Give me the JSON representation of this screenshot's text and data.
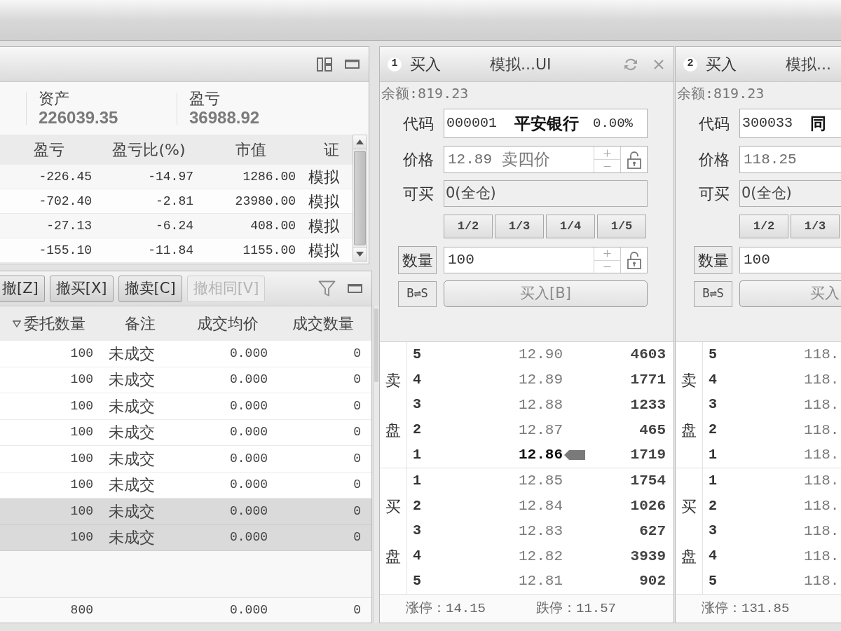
{
  "positions_panel": {
    "summary": [
      {
        "label": "资产",
        "value": "226039.35"
      },
      {
        "label": "盈亏",
        "value": "36988.92"
      }
    ],
    "table": {
      "columns": [
        "盈亏",
        "盈亏比(%)",
        "市值",
        "证"
      ],
      "rows": [
        [
          "-226.45",
          "-14.97",
          "1286.00",
          "模拟"
        ],
        [
          "-702.40",
          "-2.81",
          "23980.00",
          "模拟"
        ],
        [
          "-27.13",
          "-6.24",
          "408.00",
          "模拟"
        ],
        [
          "-155.10",
          "-11.84",
          "1155.00",
          "模拟"
        ]
      ]
    }
  },
  "orders_panel": {
    "buttons": [
      {
        "label": "撤[Z]",
        "disabled": false
      },
      {
        "label": "撤买[X]",
        "disabled": false
      },
      {
        "label": "撤卖[C]",
        "disabled": false
      },
      {
        "label": "撤相同[V]",
        "disabled": true
      }
    ],
    "table": {
      "columns": [
        {
          "label": "委托数量",
          "sorted": true
        },
        {
          "label": "备注",
          "sorted": false
        },
        {
          "label": "成交均价",
          "sorted": false
        },
        {
          "label": "成交数量",
          "sorted": false
        }
      ],
      "rows": [
        {
          "cells": [
            "100",
            "未成交",
            "0.000",
            "0"
          ],
          "selected": false
        },
        {
          "cells": [
            "100",
            "未成交",
            "0.000",
            "0"
          ],
          "selected": false
        },
        {
          "cells": [
            "100",
            "未成交",
            "0.000",
            "0"
          ],
          "selected": false
        },
        {
          "cells": [
            "100",
            "未成交",
            "0.000",
            "0"
          ],
          "selected": false
        },
        {
          "cells": [
            "100",
            "未成交",
            "0.000",
            "0"
          ],
          "selected": false
        },
        {
          "cells": [
            "100",
            "未成交",
            "0.000",
            "0"
          ],
          "selected": false
        },
        {
          "cells": [
            "100",
            "未成交",
            "0.000",
            "0"
          ],
          "selected": true
        },
        {
          "cells": [
            "100",
            "未成交",
            "0.000",
            "0"
          ],
          "selected": true
        }
      ],
      "totals": {
        "quantity": "800",
        "avg_price": "0.000",
        "filled": "0"
      }
    }
  },
  "trade_panels": [
    {
      "number": "1",
      "side": "买入",
      "account": "模拟...UI",
      "balance": "余额:819.23",
      "code": {
        "label": "代码",
        "value": "000001",
        "name": "平安银行",
        "change": "0.00%"
      },
      "price": {
        "label": "价格",
        "value": "12.89",
        "hint": "卖四价"
      },
      "available": {
        "label": "可买",
        "value": "0(全仓)"
      },
      "fractions": [
        "1/2",
        "1/3",
        "1/4",
        "1/5"
      ],
      "quantity": {
        "label": "数量",
        "value": "100"
      },
      "swap_button": "B⇌S",
      "submit_button": "买入[B]",
      "asks": {
        "label": "卖盘",
        "rows": [
          {
            "level": "5",
            "price": "12.90",
            "volume": "4603",
            "current": false
          },
          {
            "level": "4",
            "price": "12.89",
            "volume": "1771",
            "current": false
          },
          {
            "level": "3",
            "price": "12.88",
            "volume": "1233",
            "current": false
          },
          {
            "level": "2",
            "price": "12.87",
            "volume": "465",
            "current": false
          },
          {
            "level": "1",
            "price": "12.86",
            "volume": "1719",
            "current": true
          }
        ]
      },
      "bids": {
        "label": "买盘",
        "rows": [
          {
            "level": "1",
            "price": "12.85",
            "volume": "1754",
            "current": false
          },
          {
            "level": "2",
            "price": "12.84",
            "volume": "1026",
            "current": false
          },
          {
            "level": "3",
            "price": "12.83",
            "volume": "627",
            "current": false
          },
          {
            "level": "4",
            "price": "12.82",
            "volume": "3939",
            "current": false
          },
          {
            "level": "5",
            "price": "12.81",
            "volume": "902",
            "current": false
          }
        ]
      },
      "limits": [
        "涨停：14.15",
        "跌停：11.57"
      ]
    },
    {
      "number": "2",
      "side": "买入",
      "account": "模拟...",
      "balance": "余额:819.23",
      "code": {
        "label": "代码",
        "value": "300033",
        "name": "同"
      },
      "price": {
        "label": "价格",
        "value": "118.25"
      },
      "available": {
        "label": "可买",
        "value": "0(全仓)"
      },
      "fractions": [
        "1/2",
        "1/3"
      ],
      "quantity": {
        "label": "数量",
        "value": "100"
      },
      "swap_button": "B⇌S",
      "submit_button": "买入",
      "asks": {
        "label": "卖盘",
        "rows": [
          {
            "level": "5",
            "price": "118.",
            "current": false
          },
          {
            "level": "4",
            "price": "118.",
            "current": false
          },
          {
            "level": "3",
            "price": "118.",
            "current": false
          },
          {
            "level": "2",
            "price": "118.",
            "current": false
          },
          {
            "level": "1",
            "price": "118.",
            "current": false
          }
        ]
      },
      "bids": {
        "label": "买盘",
        "rows": [
          {
            "level": "1",
            "price": "118.",
            "current": false
          },
          {
            "level": "2",
            "price": "118.",
            "current": false
          },
          {
            "level": "3",
            "price": "118.",
            "current": false
          },
          {
            "level": "4",
            "price": "118.",
            "current": false
          },
          {
            "level": "5",
            "price": "118.",
            "current": false
          }
        ]
      },
      "limits": [
        "涨停：131.85"
      ]
    }
  ]
}
